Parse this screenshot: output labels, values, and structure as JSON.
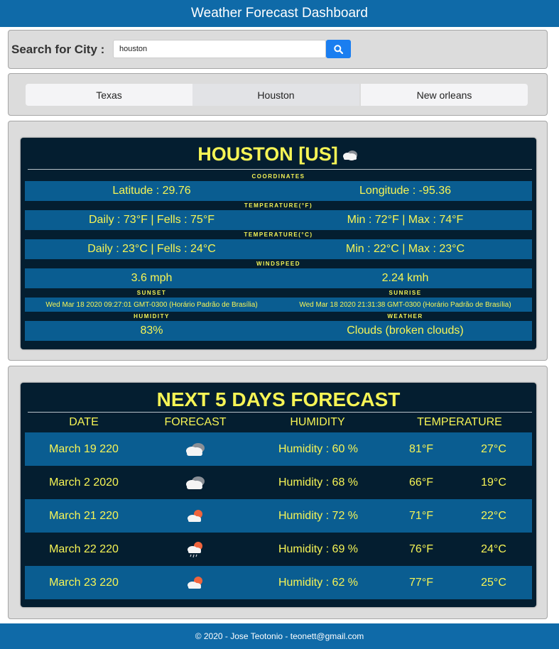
{
  "header": {
    "title": "Weather Forecast Dashboard"
  },
  "search": {
    "label": "Search for City :",
    "value": "houston",
    "icon": "search-icon"
  },
  "tabs": [
    {
      "label": "Texas",
      "active": false
    },
    {
      "label": "Houston",
      "active": true
    },
    {
      "label": "New orleans",
      "active": false
    }
  ],
  "current": {
    "city_title": "HOUSTON [US]",
    "weather_icon": "cloud-icon",
    "coordinates_label": "COORDINATES",
    "latitude": "Latitude : 29.76",
    "longitude": "Longitude : -95.36",
    "temp_f_label": "TEMPERATURE(°F)",
    "temp_f_daily": "Daily : 73°F | Fells : 75°F",
    "temp_f_minmax": "Min : 72°F | Max : 74°F",
    "temp_c_label": "TEMPERATURE(°C)",
    "temp_c_daily": "Daily : 23°C | Fells : 24°C",
    "temp_c_minmax": "Min : 22°C | Max : 23°C",
    "windspeed_label": "WINDSPEED",
    "wind_mph": "3.6 mph",
    "wind_kmh": "2.24 kmh",
    "sunset_label": "SUNSET",
    "sunrise_label": "SUNRISE",
    "sunset_value": "Wed Mar 18 2020 09:27:01 GMT-0300 (Horário Padrão de Brasília)",
    "sunrise_value": "Wed Mar 18 2020 21:31:38 GMT-0300 (Horário Padrão de Brasília)",
    "humidity_label": "HUMIDITY",
    "weather_label": "WEATHER",
    "humidity_value": "83%",
    "weather_value": "Clouds (broken clouds)"
  },
  "forecast": {
    "title": "NEXT 5 DAYS FORECAST",
    "headers": {
      "date": "DATE",
      "forecast": "FORECAST",
      "humidity": "HUMIDITY",
      "temperature": "TEMPERATURE"
    },
    "rows": [
      {
        "date": "March 19 220",
        "icon": "broken-clouds-icon",
        "humidity": "Humidity : 60 %",
        "temp_f": "81°F",
        "temp_c": "27°C"
      },
      {
        "date": "March 2 2020",
        "icon": "broken-clouds-icon",
        "humidity": "Humidity : 68 %",
        "temp_f": "66°F",
        "temp_c": "19°C"
      },
      {
        "date": "March 21 220",
        "icon": "sun-cloud-icon",
        "humidity": "Humidity : 72 %",
        "temp_f": "71°F",
        "temp_c": "22°C"
      },
      {
        "date": "March 22 220",
        "icon": "sun-cloud-rain-icon",
        "humidity": "Humidity : 69 %",
        "temp_f": "76°F",
        "temp_c": "24°C"
      },
      {
        "date": "March 23 220",
        "icon": "sun-cloud-icon",
        "humidity": "Humidity : 62 %",
        "temp_f": "77°F",
        "temp_c": "25°C"
      }
    ]
  },
  "footer": {
    "text": "© 2020 - Jose Teotonio - teonett@gmail.com"
  },
  "colors": {
    "accent": "#0f6aa8",
    "panel_dark": "#041e30",
    "row_blue": "#0a5d91",
    "text_yellow": "#f6f455",
    "button_blue": "#1a7ef0"
  }
}
